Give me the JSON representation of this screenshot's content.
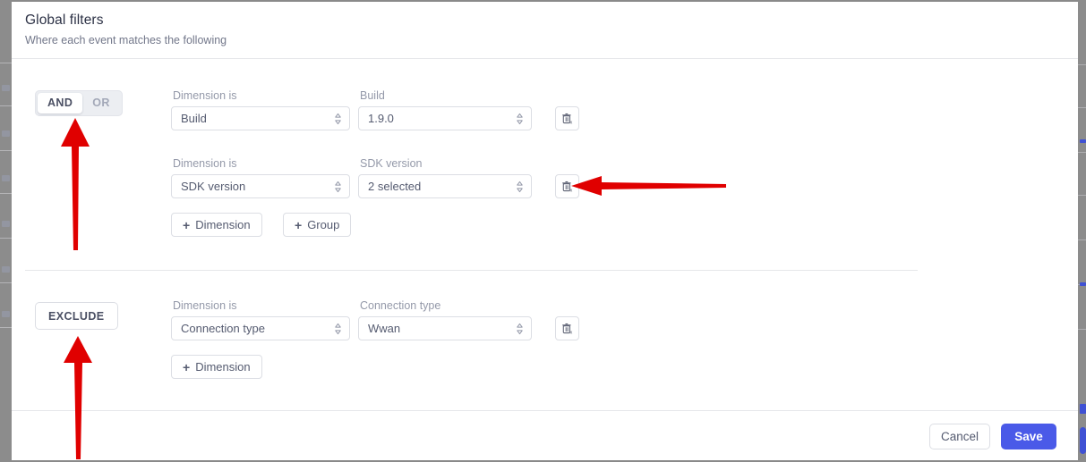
{
  "dialog": {
    "title": "Global filters",
    "subtitle": "Where each event matches the following"
  },
  "colors": {
    "accent_save": "#4a5ae8",
    "border": "#dcdee4",
    "label_muted": "#9499a9",
    "text": "#555b70",
    "annotation_arrow": "#e00000",
    "toggle_track": "#eceef2"
  },
  "groups": [
    {
      "operator": {
        "type": "segmented",
        "name": "and-or-toggle",
        "options": [
          "AND",
          "OR"
        ],
        "selected": "AND"
      },
      "rows": [
        {
          "condition_label": "Dimension is",
          "condition_value": "Build",
          "value_label": "Build",
          "value_value": "1.9.0",
          "delete_icon": "trash-remove-icon"
        },
        {
          "condition_label": "Dimension is",
          "condition_value": "SDK version",
          "value_label": "SDK version",
          "value_value": "2 selected",
          "delete_icon": "trash-remove-icon"
        }
      ],
      "actions": [
        {
          "name": "add-dimension-button",
          "plus": "+",
          "label": "Dimension"
        },
        {
          "name": "add-group-button",
          "plus": "+",
          "label": "Group"
        }
      ]
    },
    {
      "operator": {
        "type": "button",
        "name": "exclude-button",
        "label": "EXCLUDE"
      },
      "rows": [
        {
          "condition_label": "Dimension is",
          "condition_value": "Connection type",
          "value_label": "Connection type",
          "value_value": "Wwan",
          "delete_icon": "trash-remove-icon"
        }
      ],
      "actions": [
        {
          "name": "add-dimension-button",
          "plus": "+",
          "label": "Dimension"
        }
      ]
    }
  ],
  "footer": {
    "cancel_label": "Cancel",
    "save_label": "Save"
  },
  "annotations": [
    {
      "name": "arrow-up-to-and-or-toggle",
      "direction": "up"
    },
    {
      "name": "arrow-left-to-delete-sdk-version-row",
      "direction": "left"
    },
    {
      "name": "arrow-up-to-exclude-button",
      "direction": "up"
    }
  ]
}
